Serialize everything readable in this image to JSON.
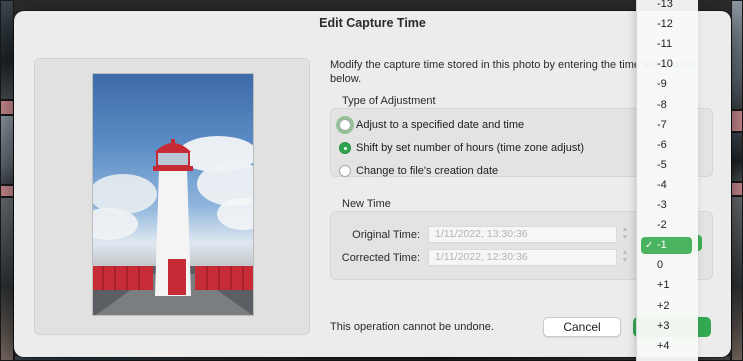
{
  "dialog": {
    "title": "Edit Capture Time",
    "description": "Modify the capture time stored in this photo by entering the time adjustment below.",
    "adjustment_section": {
      "title": "Type of Adjustment",
      "options": [
        {
          "label": "Adjust to a specified date and time",
          "checked": false,
          "focused": true
        },
        {
          "label": "Shift by set number of hours (time zone adjust)",
          "checked": true,
          "focused": false
        },
        {
          "label": "Change to file's creation date",
          "checked": false,
          "focused": false
        }
      ]
    },
    "new_time_section": {
      "title": "New Time",
      "original_label": "Original Time:",
      "original_value": "1/11/2022, 13:30:36",
      "corrected_label": "Corrected Time:",
      "corrected_value": "1/11/2022, 12:30:36"
    },
    "footer_note": "This operation cannot be undone.",
    "cancel_label": "Cancel"
  },
  "hour_menu": {
    "items": [
      "-13",
      "-12",
      "-11",
      "-10",
      "-9",
      "-8",
      "-7",
      "-6",
      "-5",
      "-4",
      "-3",
      "-2",
      "-1",
      "0",
      "+1",
      "+2",
      "+3",
      "+4"
    ],
    "selected": "-1",
    "check_mark": "✓"
  },
  "colors": {
    "accent": "#32a852",
    "selected_item": "#49b35e",
    "dialog_bg": "#ececec"
  }
}
